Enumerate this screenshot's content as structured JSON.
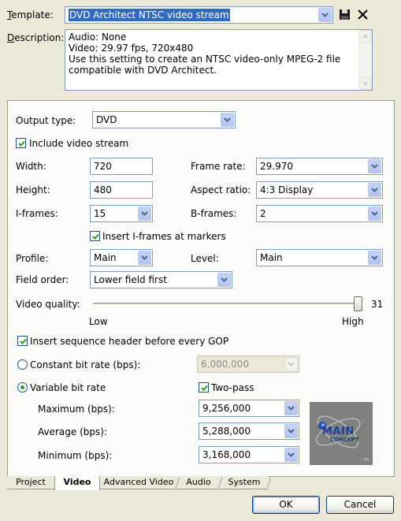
{
  "template": {
    "label": "Template:",
    "value": "DVD Architect NTSC video stream",
    "save_icon": "floppy-disk-icon",
    "delete_icon": "close-x-icon"
  },
  "description": {
    "label": "Description:",
    "lines": [
      "Audio: None",
      "Video: 29.97 fps, 720x480",
      "Use this setting to create an NTSC video-only MPEG-2 file",
      "compatible with DVD Architect."
    ]
  },
  "output_type": {
    "label": "Output type:",
    "value": "DVD"
  },
  "include_video": {
    "label": "Include video stream",
    "checked": true
  },
  "width": {
    "label": "Width:",
    "value": "720"
  },
  "height": {
    "label": "Height:",
    "value": "480"
  },
  "frame_rate": {
    "label": "Frame rate:",
    "value": "29.970"
  },
  "aspect_ratio": {
    "label": "Aspect ratio:",
    "value": "4:3 Display"
  },
  "i_frames": {
    "label": "I-frames:",
    "value": "15"
  },
  "b_frames": {
    "label": "B-frames:",
    "value": "2"
  },
  "insert_iframes": {
    "label": "Insert I-frames at markers",
    "checked": true
  },
  "profile": {
    "label": "Profile:",
    "value": "Main"
  },
  "level": {
    "label": "Level:",
    "value": "Main"
  },
  "field_order": {
    "label": "Field order:",
    "value": "Lower field first"
  },
  "video_quality": {
    "label": "Video quality:",
    "value": "31",
    "low": "Low",
    "high": "High",
    "level": 1.0
  },
  "seq_header": {
    "label": "Insert sequence header before every GOP",
    "checked": true
  },
  "cbr": {
    "label": "Constant bit rate (bps):",
    "value": "6,000,000",
    "selected": false
  },
  "vbr": {
    "label": "Variable bit rate",
    "selected": true
  },
  "two_pass": {
    "label": "Two-pass",
    "checked": true
  },
  "maximum": {
    "label": "Maximum (bps):",
    "value": "9,256,000"
  },
  "average": {
    "label": "Average (bps):",
    "value": "5,288,000"
  },
  "minimum": {
    "label": "Minimum (bps):",
    "value": "3,168,000"
  },
  "logo": {
    "line1": "MAIN",
    "line2": "CONCEPT",
    "tm": "TM"
  },
  "tabs": [
    "Project",
    "Video",
    "Advanced Video",
    "Audio",
    "System"
  ],
  "active_tab": "Video",
  "buttons": {
    "ok": "OK",
    "cancel": "Cancel"
  },
  "colors": {
    "template_highlight": "#316ac5",
    "panel_bg": "#fbfbf9",
    "dialog_bg": "#ece9d8"
  }
}
